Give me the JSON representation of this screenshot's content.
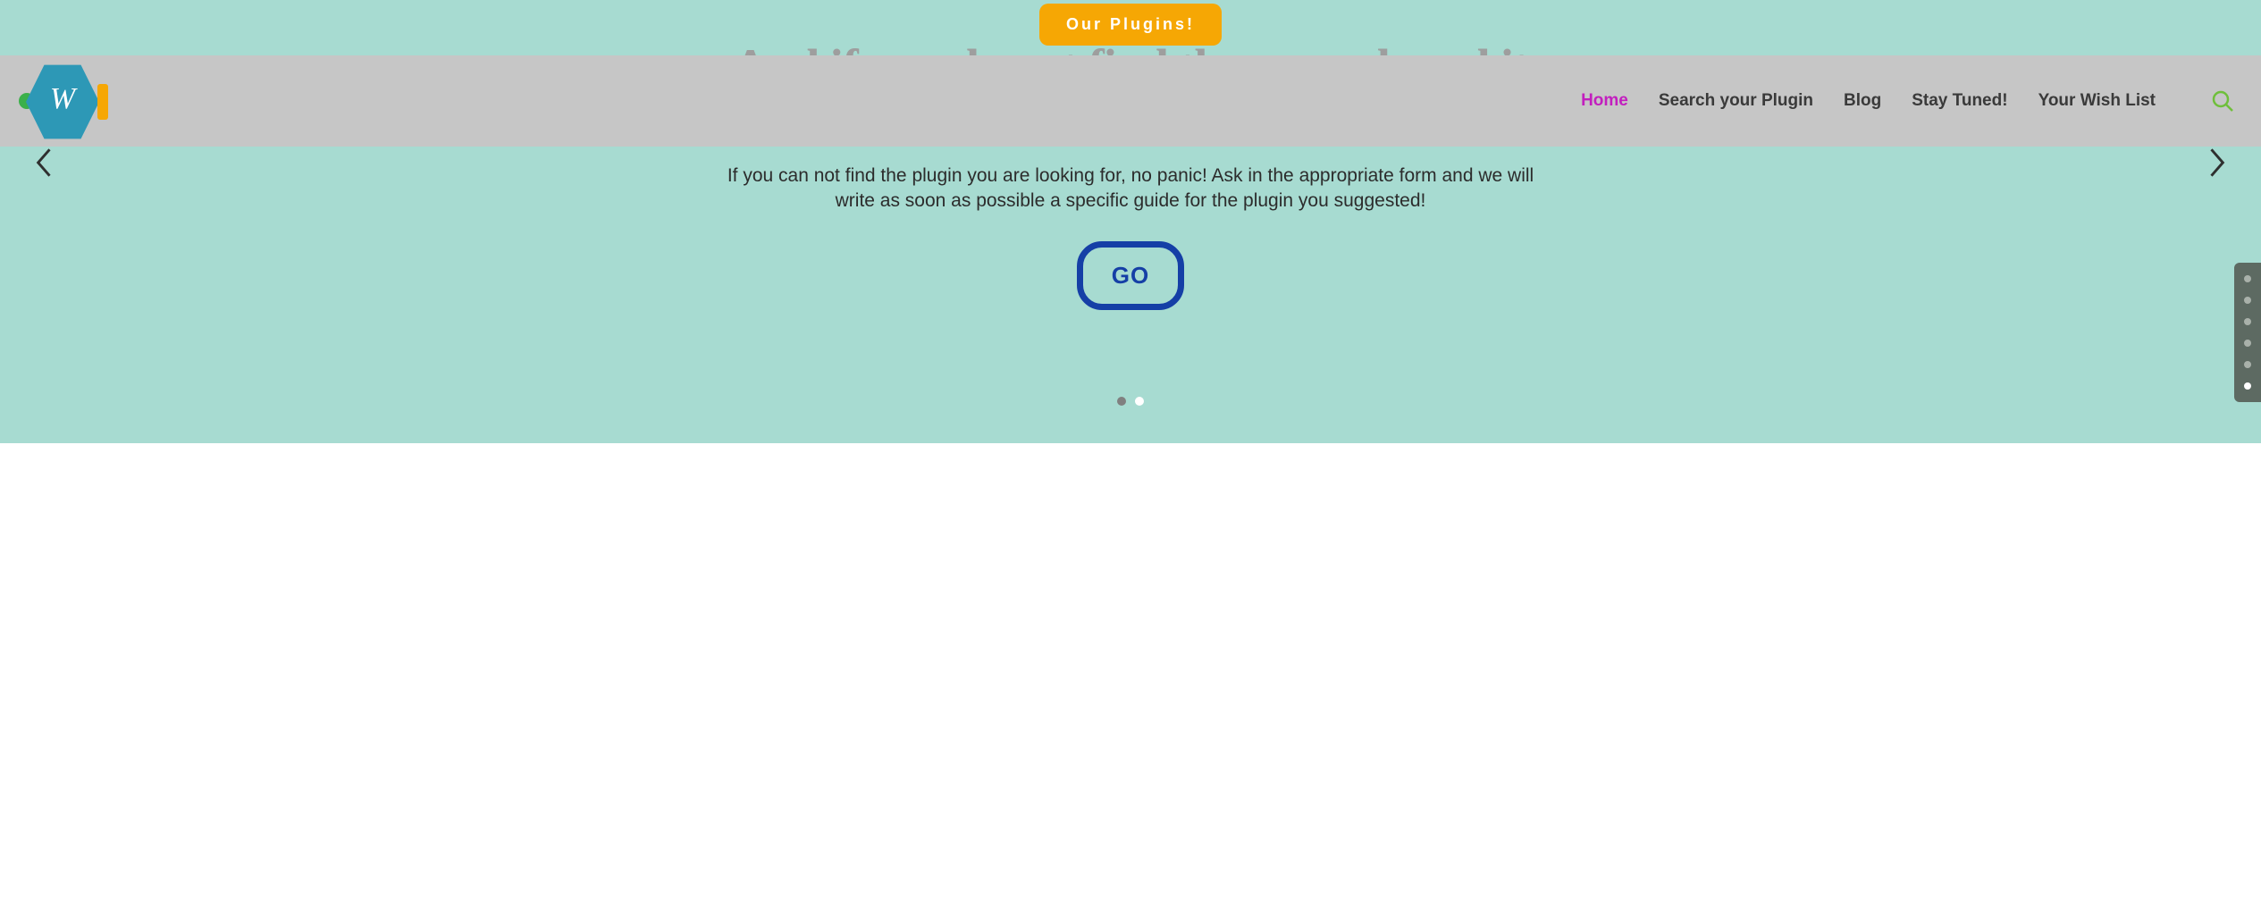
{
  "top_cta": "Our Plugins!",
  "nav": {
    "home": "Home",
    "search_plugin": "Search your Plugin",
    "blog": "Blog",
    "stay_tuned": "Stay Tuned!",
    "wish_list": "Your Wish List"
  },
  "logo_letter": "W",
  "hero": {
    "title": "And if you do not find them ... ask and it will be posted!",
    "subtitle": "If you can not find the plugin you are looking for, no panic! Ask in the appropriate form and we will write as soon as possible a specific guide for the plugin you suggested!",
    "go_label": "GO"
  },
  "slider": {
    "total": 2,
    "active_index": 1
  },
  "side_nav": {
    "count": 6,
    "active_index": 5
  }
}
